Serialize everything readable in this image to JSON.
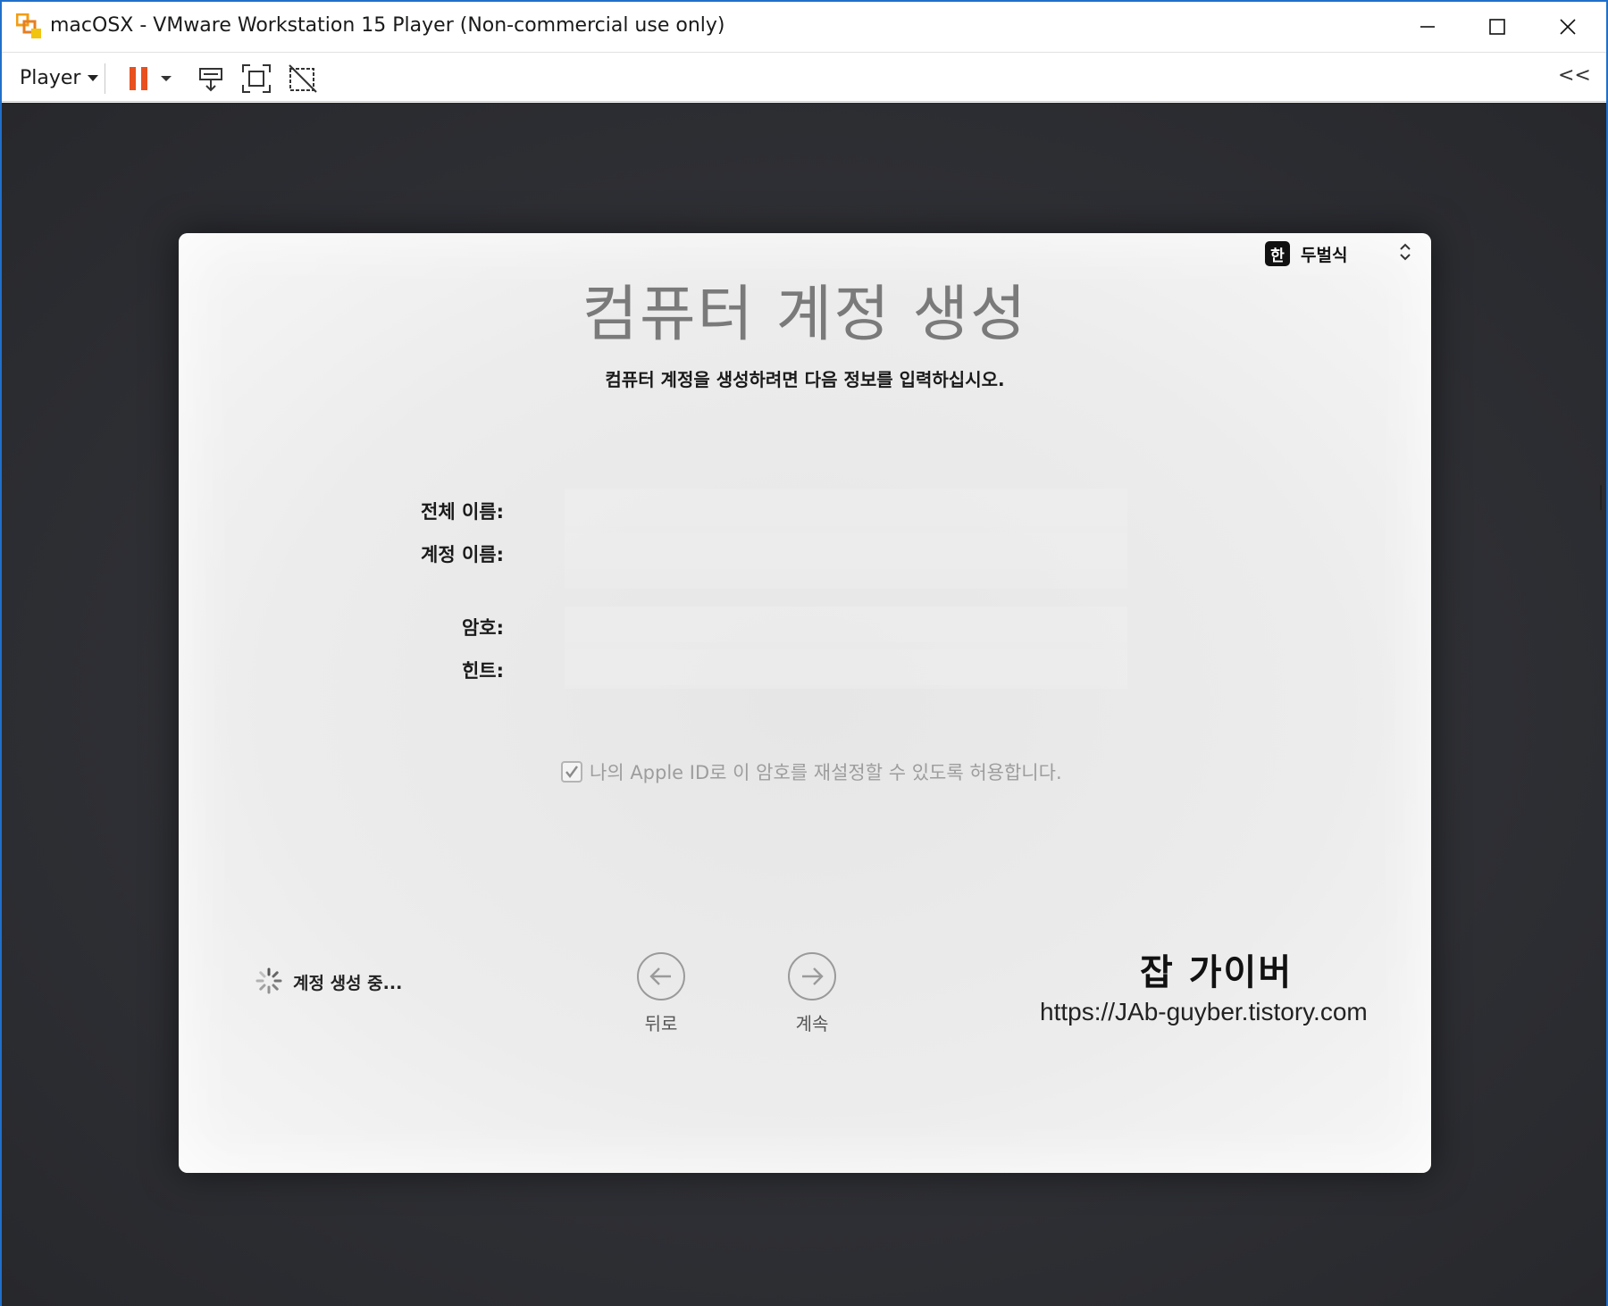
{
  "window": {
    "title": "macOSX - VMware Workstation 15 Player (Non-commercial use only)",
    "border_color": "#1f6fc9"
  },
  "toolbar": {
    "player_label": "Player",
    "pause_color": "#e8501e",
    "collapse_label": "<<",
    "icons": [
      "pause-icon",
      "dropdown-arrow-icon",
      "send-ctrl-alt-del-icon",
      "fullscreen-icon",
      "unity-icon"
    ]
  },
  "mac": {
    "input_source": {
      "badge": "한",
      "label": "두벌식"
    },
    "title": "컴퓨터 계정 생성",
    "subtitle": "컴퓨터 계정을 생성하려면 다음 정보를 입력하십시오.",
    "fields": {
      "full_name_label": "전체 이름:",
      "account_name_label": "계정 이름:",
      "password_label": "암호:",
      "hint_label": "힌트:"
    },
    "checkbox": {
      "label": "나의 Apple ID로 이 암호를 재설정할 수 있도록 허용합니다.",
      "checked": true
    },
    "status": "계정 생성 중...",
    "back_label": "뒤로",
    "continue_label": "계속"
  },
  "watermark": {
    "title": "잡 가이버",
    "url": "https://JAb-guyber.tistory.com"
  }
}
